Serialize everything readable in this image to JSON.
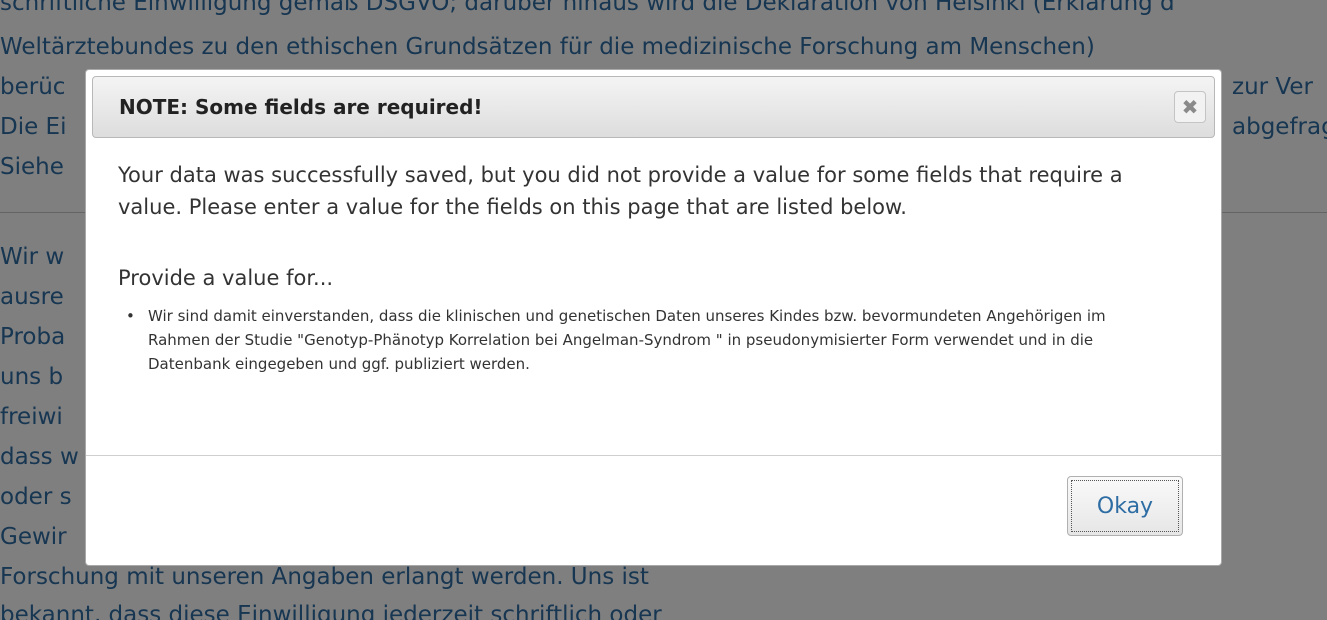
{
  "background": {
    "lines": [
      "schriftliche Einwilligung gemäß DSGVO; darüber hinaus wird die Deklaration von Helsinki (Erklärung d",
      "Weltärztebundes zu den ethischen Grundsätzen für die medizinische Forschung am Menschen)",
      "berüc",
      "Die Ei",
      "Siehe",
      "Wir w",
      "ausre",
      "Proba",
      "uns b",
      "freiwi",
      "dass w",
      "oder s",
      "Gewir",
      "Forschung mit unseren Angaben erlangt werden. Uns ist",
      "bekannt, dass diese Einwilligung jederzeit schriftlich oder"
    ],
    "right_fragments": [
      "zur Ver",
      "abgefrag"
    ],
    "text_color": "#2e6da4"
  },
  "dialog": {
    "title": "NOTE: Some fields are required!",
    "close_icon": "close-icon",
    "close_glyph": "✖",
    "message": "Your data was successfully saved, but you did not provide a value for some fields that require a value. Please enter a value for the fields on this page that are listed below.",
    "provide_label": "Provide a value for...",
    "fields": [
      "Wir sind damit einverstanden, dass die klinischen und genetischen Daten unseres Kindes bzw. bevormundeten Angehörigen im Rahmen der Studie \"Genotyp-Phänotyp Korrelation bei Angelman-Syndrom \" in pseudonymisierter Form verwendet und in die Datenbank eingegeben und ggf. publiziert werden."
    ],
    "bullet": "•",
    "okay_label": "Okay"
  }
}
